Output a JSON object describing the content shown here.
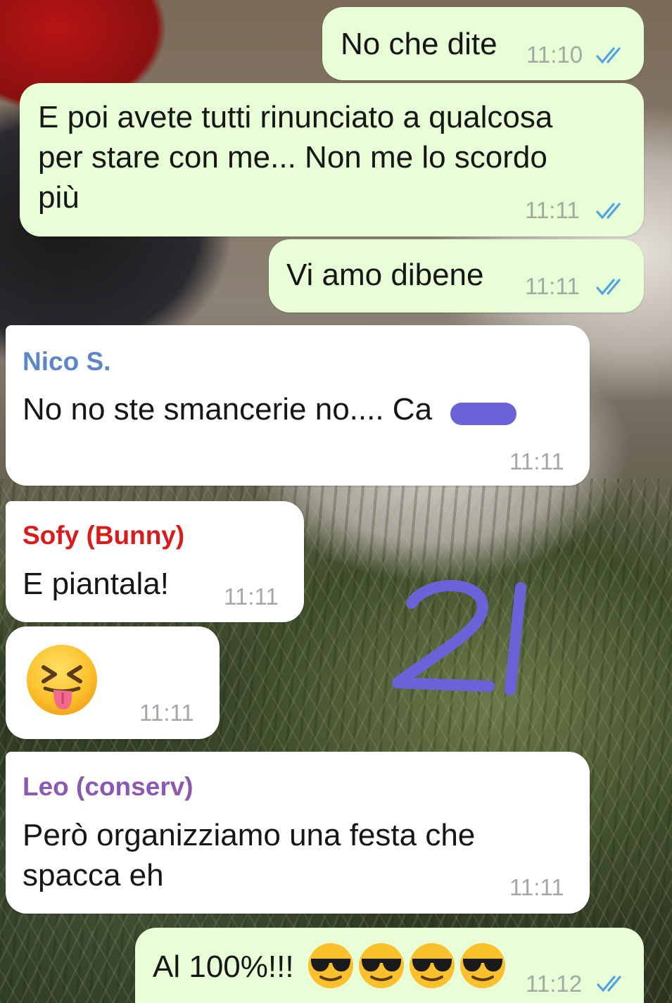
{
  "messages": [
    {
      "type": "out",
      "text": "No che dite",
      "time": "11:10"
    },
    {
      "type": "out",
      "text": "E poi avete tutti rinunciato a qualcosa\nper stare con me... Non me lo scordo\npiù",
      "time": "11:11"
    },
    {
      "type": "out",
      "text": "Vi amo dibene",
      "time": "11:11"
    },
    {
      "type": "in",
      "sender": "Nico S.",
      "text": "No no ste smancerie no.... Ca",
      "time": "11:11"
    },
    {
      "type": "in",
      "sender": "Sofy (Bunny)",
      "text": "E piantala!",
      "time": "11:11"
    },
    {
      "type": "in",
      "emoji": "squinting-face-with-tongue",
      "time": "11:11"
    },
    {
      "type": "in",
      "sender": "Leo (conserv)",
      "text": "Però organizziamo una festa che\nspacca eh",
      "time": "11:11"
    },
    {
      "type": "out",
      "text": "Al 100%!!! ",
      "emoji": "smiling-face-with-sunglasses x4",
      "time": "11:12"
    }
  ],
  "annotation": "21",
  "colors": {
    "outgoing_bubble": "#e7fed6",
    "incoming_bubble": "#ffffff",
    "read_ticks": "#4fa3e0",
    "nico": "#5b88c4",
    "sofy": "#d81b1b",
    "leo": "#8b5ab0",
    "redaction": "#6a63d8",
    "annotation": "#6a63d8"
  }
}
